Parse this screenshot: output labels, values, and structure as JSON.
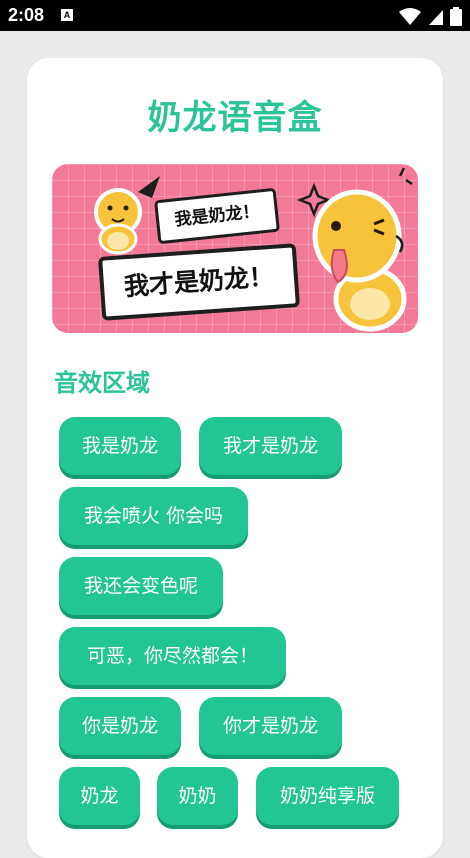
{
  "status_bar": {
    "time": "2:08",
    "notification_icon": "a-icon",
    "icons": [
      "wifi-icon",
      "signal-icon",
      "battery-icon"
    ]
  },
  "app": {
    "title": "奶龙语音盒"
  },
  "banner": {
    "bubble_small": "我是奶龙！",
    "bubble_big": "我才是奶龙！"
  },
  "section": {
    "title": "音效区域"
  },
  "sound_buttons": [
    "我是奶龙",
    "我才是奶龙",
    "我会喷火 你会吗",
    "我还会变色呢",
    "可恶，你尽然都会！",
    "你是奶龙",
    "你才是奶龙",
    "奶龙",
    "奶奶",
    "奶奶纯享版"
  ],
  "colors": {
    "accent": "#2ac39a",
    "button": "#22c694",
    "button_shadow": "#159c72",
    "banner_bg": "#f27a98"
  }
}
